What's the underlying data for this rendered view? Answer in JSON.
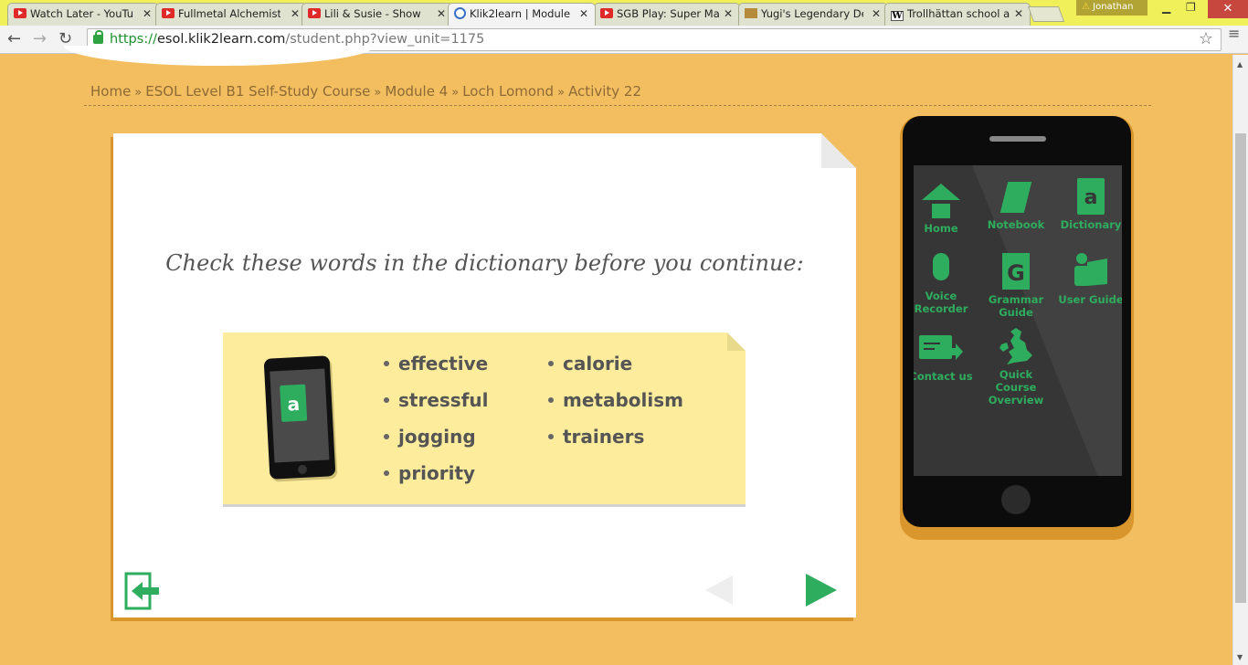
{
  "browser": {
    "tabs": [
      {
        "title": "Watch Later - YouTube",
        "icon": "youtube-icon"
      },
      {
        "title": "Fullmetal Alchemist",
        "icon": "youtube-icon"
      },
      {
        "title": "Lili & Susie - Show",
        "icon": "youtube-icon"
      },
      {
        "title": "Klik2learn | Module",
        "icon": "klik2learn-icon",
        "active": true
      },
      {
        "title": "SGB Play: Super Ma",
        "icon": "youtube-icon"
      },
      {
        "title": "Yugi's Legendary De",
        "icon": "yugioh-icon"
      },
      {
        "title": "Trollhättan school a",
        "icon": "wikipedia-icon"
      }
    ],
    "user": "Jonathan",
    "url_protocol": "https://",
    "url_host": "esol.klik2learn.com",
    "url_path": "/student.php?view_unit=1175"
  },
  "breadcrumb": [
    "Home",
    "ESOL Level B1 Self-Study Course",
    "Module 4",
    "Loch Lomond",
    "Activity 22"
  ],
  "breadcrumb_sep": "»",
  "activity": {
    "heading": "Check these words in the dictionary before you continue:",
    "words_col1": [
      "effective",
      "stressful",
      "jogging",
      "priority"
    ],
    "words_col2": [
      "calorie",
      "metabolism",
      "trainers"
    ],
    "dict_letter": "a"
  },
  "phone_menu": {
    "home": "Home",
    "notebook": "Notebook",
    "dictionary": "Dictionary",
    "dictionary_letter": "a",
    "voice_recorder_1": "Voice",
    "voice_recorder_2": "Recorder",
    "grammar_guide_1": "Grammar",
    "grammar_guide_2": "Guide",
    "grammar_letter": "G",
    "user_guide": "User Guide",
    "contact_us": "Contact us",
    "quick_course_1": "Quick Course",
    "quick_course_2": "Overview"
  },
  "colors": {
    "page_bg": "#f3be60",
    "accent_green": "#2ead5e",
    "note_yellow": "#fcec9c"
  }
}
